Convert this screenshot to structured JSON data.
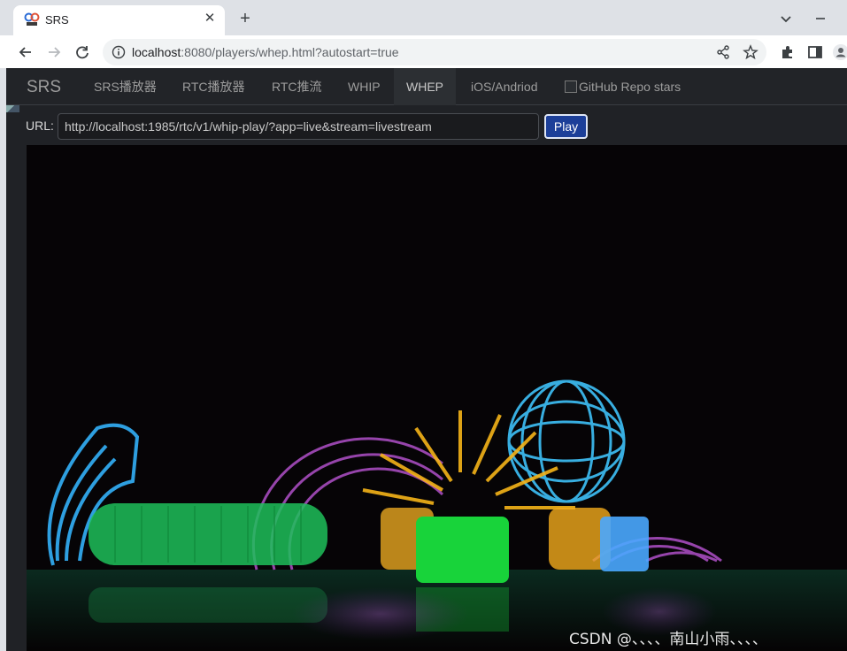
{
  "browser": {
    "tab": {
      "title": "SRS",
      "close_glyph": "✕"
    },
    "new_tab_glyph": "+",
    "address_bar": {
      "host": "localhost",
      "rest": ":8080/players/whep.html?autostart=true"
    }
  },
  "site": {
    "brand": "SRS",
    "nav": [
      {
        "label": "SRS播放器",
        "active": false
      },
      {
        "label": "RTC播放器",
        "active": false
      },
      {
        "label": "RTC推流",
        "active": false
      },
      {
        "label": "WHIP",
        "active": false
      },
      {
        "label": "WHEP",
        "active": true
      },
      {
        "label": "iOS/Andriod",
        "active": false
      }
    ],
    "github_badge_alt": "GitHub Repo stars"
  },
  "player": {
    "url_label": "URL:",
    "url_value": "http://localhost:1985/rtc/v1/whip-play/?app=live&stream=livestream",
    "play_label": "Play"
  },
  "video": {
    "watermark": "CSDN @、、、、南山小雨、、、、"
  },
  "colors": {
    "play_button": "#1c3f99",
    "navbar_bg": "#222428"
  }
}
